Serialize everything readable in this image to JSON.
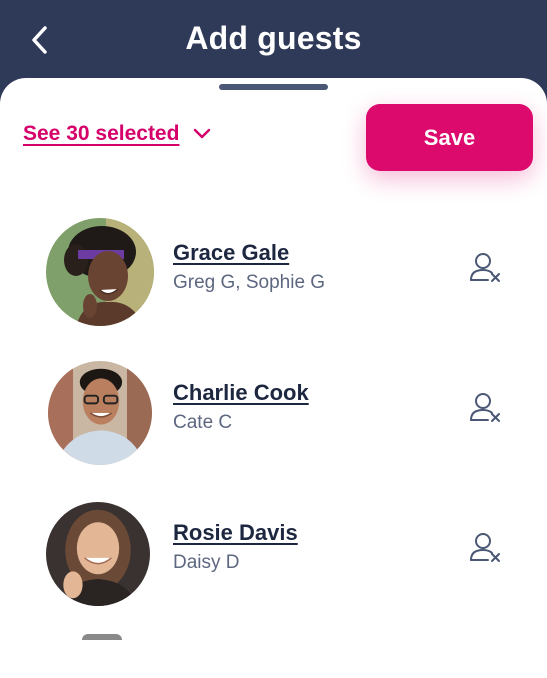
{
  "header": {
    "title": "Add guests",
    "back_icon": "chevron-left-icon"
  },
  "selection": {
    "see_selected_label": "See 30 selected",
    "chevron_icon": "chevron-down-icon"
  },
  "actions": {
    "save_label": "Save"
  },
  "colors": {
    "header_bg": "#2e3a57",
    "accent": "#dd0a6e",
    "text_dark": "#1d2740",
    "text_muted": "#5d6780"
  },
  "guests": [
    {
      "name": "Grace Gale",
      "companions": "Greg G, Sophie G",
      "remove_icon": "remove-user-icon"
    },
    {
      "name": "Charlie Cook",
      "companions": "Cate C",
      "remove_icon": "remove-user-icon"
    },
    {
      "name": "Rosie Davis",
      "companions": "Daisy D",
      "remove_icon": "remove-user-icon"
    }
  ]
}
